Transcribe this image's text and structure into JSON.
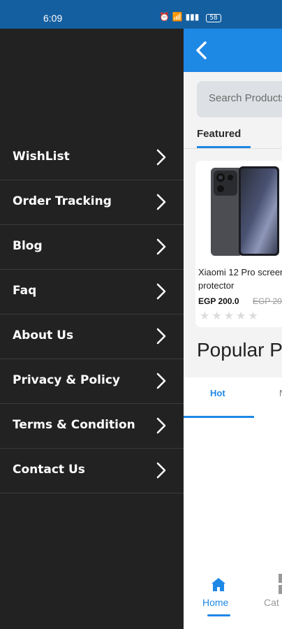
{
  "status_bar": {
    "time": "6:09",
    "battery": "58"
  },
  "search": {
    "placeholder": "Search Products"
  },
  "tabs": {
    "featured": "Featured"
  },
  "product": {
    "name": "Xiaomi 12 Pro screen protector",
    "price": "EGP 200.0",
    "old_price": "EGP 20"
  },
  "section": {
    "popular": "Popular P"
  },
  "popular_tabs": {
    "hot": "Hot",
    "next": "N"
  },
  "bottom_nav": {
    "home": "Home",
    "categories": "Cat"
  },
  "drawer": {
    "items": [
      {
        "label": "WishList"
      },
      {
        "label": "Order Tracking"
      },
      {
        "label": "Blog"
      },
      {
        "label": "Faq"
      },
      {
        "label": "About Us"
      },
      {
        "label": "Privacy & Policy"
      },
      {
        "label": "Terms & Condition"
      },
      {
        "label": "Contact Us"
      }
    ]
  },
  "colors": {
    "accent": "#1e88e5",
    "drawer_bg": "#222222"
  }
}
